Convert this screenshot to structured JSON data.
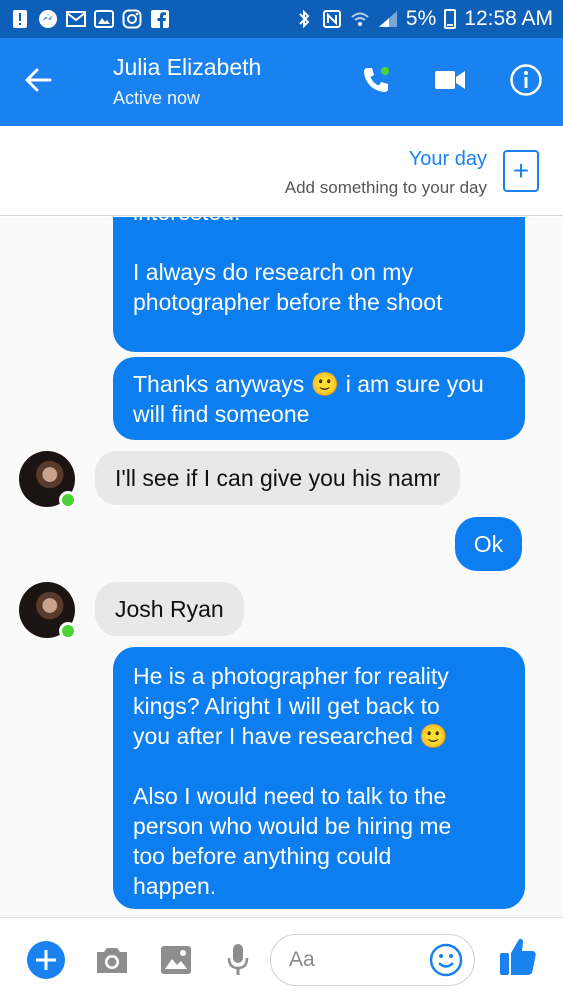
{
  "status_bar": {
    "battery_percent": "5%",
    "time": "12:58 AM"
  },
  "header": {
    "contact_name": "Julia Elizabeth",
    "contact_status": "Active now"
  },
  "your_day": {
    "title": "Your day",
    "subtitle": "Add something to your day"
  },
  "messages": [
    {
      "direction": "outgoing",
      "text": "interested.\n\nI always do research on my\nphotographer before the shoot"
    },
    {
      "direction": "outgoing",
      "text": "Thanks anyways 🙂 i am sure you\nwill find someone"
    },
    {
      "direction": "incoming",
      "text": "I'll see if I can give you his namr"
    },
    {
      "direction": "outgoing",
      "text": "Ok"
    },
    {
      "direction": "incoming",
      "text": "Josh Ryan"
    },
    {
      "direction": "outgoing",
      "text": "He is a photographer for reality\nkings? Alright I will get back to\nyou after I have researched 🙂\n\nAlso I would need to talk to the\nperson who would be hiring me\ntoo before anything could\nhappen."
    }
  ],
  "composer": {
    "placeholder": "Aa"
  },
  "colors": {
    "status_bar": "#0d5fb8",
    "header": "#1a82f0",
    "outgoing_bubble": "#0d7ef0",
    "incoming_bubble": "#e8e8e8",
    "online_dot": "#4cd137"
  },
  "icons": {
    "status_left": [
      "alert-icon",
      "messenger-icon",
      "mail-icon",
      "gallery-icon",
      "instagram-icon",
      "facebook-icon"
    ],
    "status_right": [
      "bluetooth-icon",
      "nfc-icon",
      "wifi-icon",
      "signal-icon",
      "battery-icon"
    ],
    "header": [
      "back-arrow-icon",
      "phone-icon",
      "video-camera-icon",
      "info-icon"
    ],
    "composer": [
      "plus-icon",
      "camera-icon",
      "image-icon",
      "microphone-icon",
      "emoji-icon",
      "thumbs-up-icon"
    ]
  }
}
